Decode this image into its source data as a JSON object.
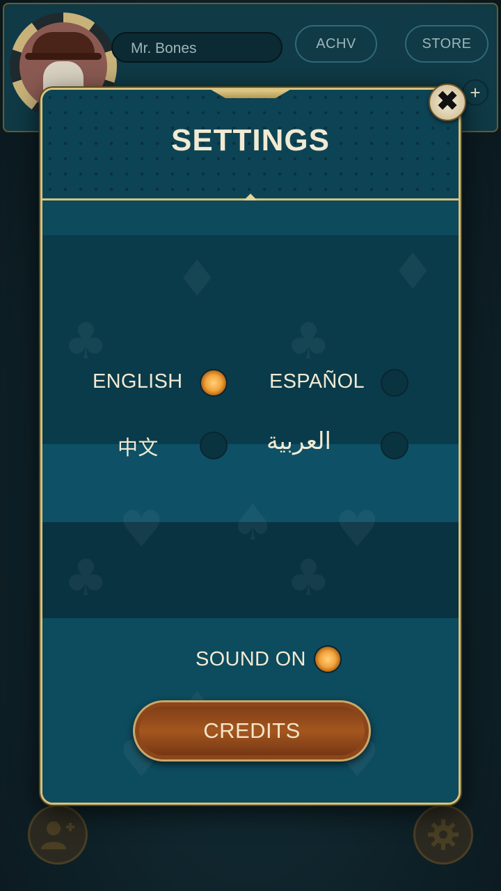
{
  "player": {
    "name": "Mr. Bones"
  },
  "top_bar": {
    "achv_label": "ACHV",
    "store_label": "STORE",
    "plus_glyph": "+"
  },
  "settings": {
    "title": "SETTINGS",
    "close_glyph": "✖",
    "languages": [
      {
        "label": "ENGLISH",
        "selected": true
      },
      {
        "label": "ESPAÑOL",
        "selected": false
      },
      {
        "label": "中文",
        "selected": false
      },
      {
        "label": "العربية",
        "selected": false
      }
    ],
    "sound": {
      "label": "SOUND ON",
      "enabled": true
    },
    "credits_label": "CREDITS"
  },
  "colors": {
    "accent_gold": "#d8c27c",
    "panel_teal": "#0c4a5c",
    "radio_on": "#f3a33c",
    "credits_brown": "#a4561f"
  },
  "icons": [
    "close-icon",
    "add-friend-icon",
    "gear-icon",
    "plus-icon"
  ]
}
